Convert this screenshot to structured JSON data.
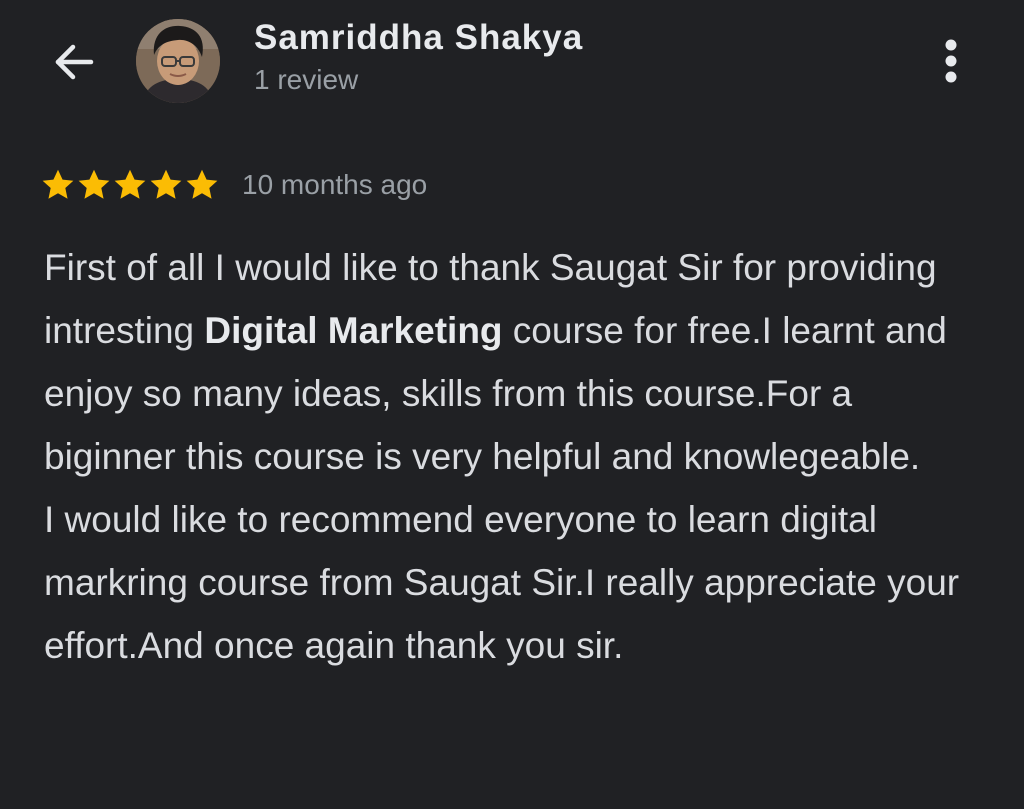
{
  "header": {
    "back_icon": "arrow-left-icon",
    "user_name": "Samriddha Shakya",
    "review_count": "1 review",
    "menu_icon": "more-vertical-icon"
  },
  "review": {
    "rating": 5,
    "rating_max": 5,
    "star_color": "#fbbc04",
    "date": "10 months ago",
    "paragraph_1": {
      "before_bold": "First of all I would like to thank Saugat Sir for providing intresting ",
      "bold": "Digital Marketing",
      "after_bold": " course for free.I learnt and enjoy so many ideas, skills from this course.For a biginner this course is very helpful and knowlegeable."
    },
    "paragraph_2": "I would like to recommend everyone to learn digital markring course from Saugat Sir.I really appreciate your effort.And once again thank you sir."
  },
  "colors": {
    "background": "#202124",
    "primary_text": "#e8eaed",
    "secondary_text": "#9aa0a6"
  }
}
